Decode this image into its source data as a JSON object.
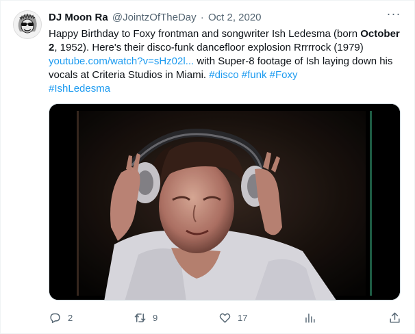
{
  "author": {
    "display_name": "DJ Moon Ra",
    "handle": "@JointzOfTheDay",
    "separator": "·",
    "date": "Oct 2, 2020"
  },
  "more_label": "···",
  "tweet": {
    "t1": "Happy Birthday to Foxy frontman and songwriter Ish Ledesma (born ",
    "t_bold": "October 2",
    "t2": ", 1952). Here's their disco-funk dancefloor explosion Rrrrrock (1979) ",
    "link": "youtube.com/watch?v=sHz02l...",
    "t3": " with Super-8 footage of Ish laying down his vocals at Criteria Studios in Miami. ",
    "hashtags": [
      "#disco",
      "#funk",
      "#Foxy",
      "#IshLedesma"
    ]
  },
  "actions": {
    "replies": "2",
    "retweets": "9",
    "likes": "17"
  },
  "icons": {
    "reply": "reply-icon",
    "retweet": "retweet-icon",
    "like": "heart-icon",
    "views": "analytics-icon",
    "share": "share-icon"
  },
  "colors": {
    "link": "#1d9bf0",
    "secondary_text": "#536471",
    "primary_text": "#0f1419"
  }
}
